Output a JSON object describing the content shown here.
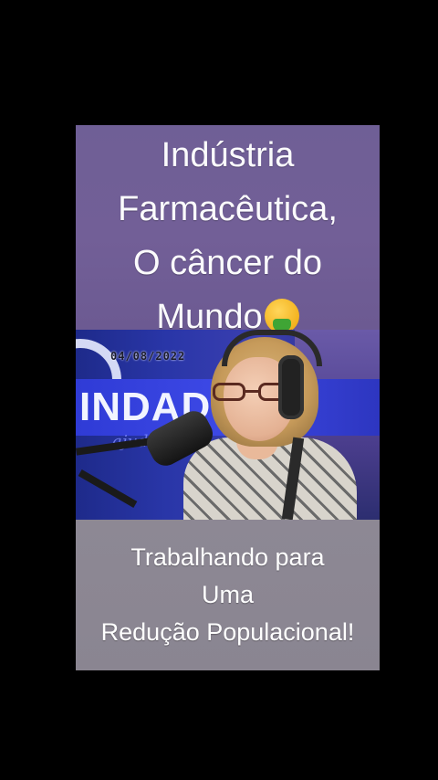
{
  "top_caption": {
    "line1": "Indústria",
    "line2": "Farmacêutica,",
    "line3": "O câncer do",
    "line4": "Mundo",
    "emoji": "nauseated-face-emoji"
  },
  "video": {
    "date": "04/08/2022",
    "logo_text": "INDAD",
    "script_text": "ajudar",
    "subject": "woman-with-headphones-and-microphone"
  },
  "bottom_caption": {
    "line1": "Trabalhando para",
    "line2": "Uma",
    "line3": "Redução Populacional!"
  },
  "colors": {
    "background": "#000000",
    "top_caption_bg": "#725f97",
    "bottom_caption_bg": "#8d8894",
    "caption_text": "#ffffff"
  }
}
